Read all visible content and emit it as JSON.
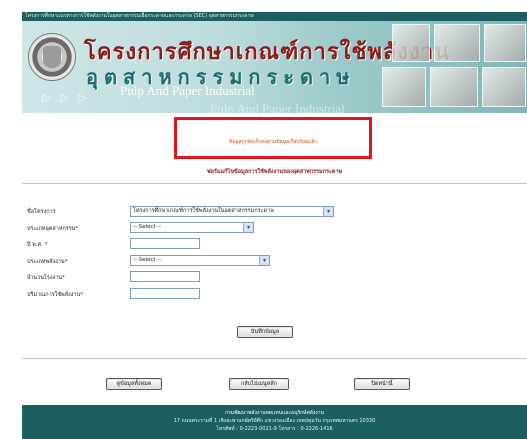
{
  "browser": {
    "top_text": ""
  },
  "header": {
    "strip_text": "โครงการศึกษาแนวทางการใช้พลังงานในอุตสาหกรรมเยื่อกระดาษและกระดาษ (SEC) อุตสาหกรรมกระดาษ",
    "title_th_line1": "โครงการศึกษาเกณฑ์การใช้พลังงาน",
    "title_th_line2": "อุตสาหกรรมกระดาษ",
    "title_en_line1": "Pulp And Paper Industrial",
    "title_en_line2": "Pulp And Paper Industrial",
    "deco": "▷ ▷ ▷"
  },
  "message": {
    "success": "ข้อมูลถูกจัดเก็บลงฐานข้อมูลเรียบร้อยแล้ว"
  },
  "form": {
    "title": "ฟอร์มแก้ไขข้อมูลการใช้พลังงานของอุตสาหกรรมกระดาษ",
    "fields": [
      {
        "label": "ชื่อโครงการ",
        "value": "โครงการศึกษาเกณฑ์การใช้พลังงานในอุตสาหกรรมกระดาษ"
      },
      {
        "label": "ประเภทอุตสาหกรรม*",
        "value": "-- Select --"
      },
      {
        "label": "ปี พ.ศ. *",
        "value": ""
      },
      {
        "label": "ประเภทพลังงาน*",
        "value": "-- Select --"
      },
      {
        "label": "จำนวนโรงงาน*",
        "value": ""
      },
      {
        "label": "ปริมาณการใช้พลังงาน*",
        "value": ""
      }
    ],
    "save_button": "บันทึกข้อมูล"
  },
  "nav": {
    "view_all": "ดูข้อมูลทั้งหมด",
    "back_home": "กลับไปเมนูหลัก",
    "close_window": "ปิดหน้านี้"
  },
  "footer": {
    "line1": "กรมพัฒนาพลังงานทดแทนและอนุรักษ์พลังงาน",
    "line2": "17 ถนนพระรามที่ 1 เชิงสะพานกษัตริย์ศึก แขวงรองเมือง เขตปทุมวัน กรุงเทพมหานคร 10330",
    "line3": "โทรศัพท์ : 0-2223-0021-9 โทรสาร : 0-2226-1416"
  },
  "colors": {
    "header_teal": "#1b5f63",
    "title_red": "#8b1a1a",
    "highlight_red": "#e0151c",
    "message_orange": "#cc4b00"
  },
  "icons": {
    "select_arrow": "chevron-down-icon"
  }
}
